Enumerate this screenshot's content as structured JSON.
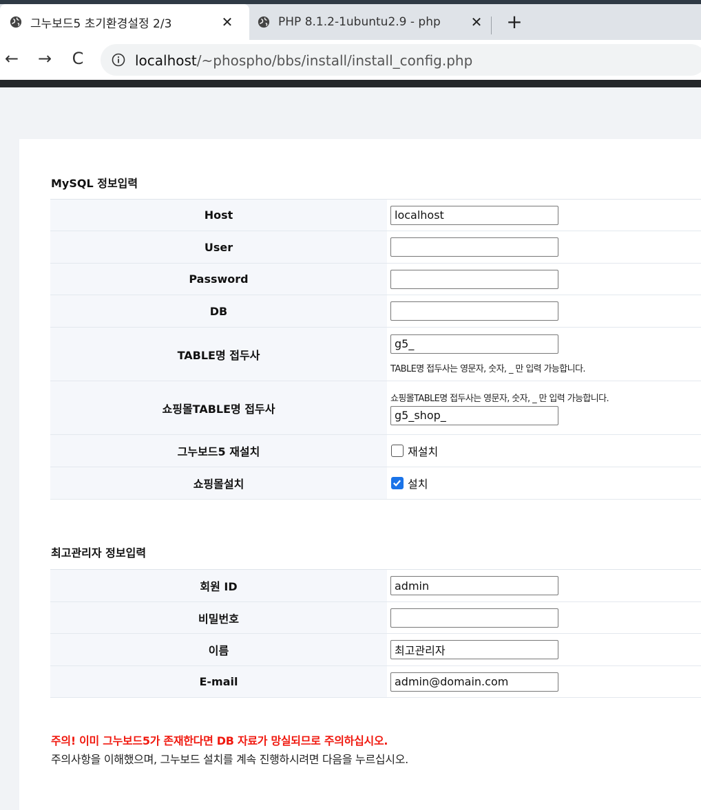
{
  "browser": {
    "tabs": [
      {
        "title": "그누보드5 초기환경설정 2/3",
        "active": true
      },
      {
        "title": "PHP 8.1.2-1ubuntu2.9 - php",
        "active": false
      }
    ],
    "close_glyph": "✕",
    "new_tab_glyph": "+",
    "nav": {
      "back": "←",
      "forward": "→",
      "reload": "C"
    },
    "url_host": "localhost",
    "url_path": "/~phospho/bbs/install/install_config.php"
  },
  "mysql": {
    "title": "MySQL 정보입력",
    "host_label": "Host",
    "host_value": "localhost",
    "user_label": "User",
    "user_value": "",
    "password_label": "Password",
    "password_value": "",
    "db_label": "DB",
    "db_value": "",
    "prefix_label": "TABLE명 접두사",
    "prefix_value": "g5_",
    "prefix_help": "TABLE명 접두사는 영문자, 숫자, _ 만 입력 가능합니다.",
    "shop_prefix_label": "쇼핑몰TABLE명 접두사",
    "shop_prefix_help": "쇼핑몰TABLE명 접두사는 영문자, 숫자, _ 만 입력 가능합니다.",
    "shop_prefix_value": "g5_shop_",
    "reinstall_label": "그누보드5 재설치",
    "reinstall_checkbox": "재설치",
    "reinstall_checked": false,
    "shop_install_label": "쇼핑몰설치",
    "shop_install_checkbox": "설치",
    "shop_install_checked": true
  },
  "admin": {
    "title": "최고관리자 정보입력",
    "id_label": "회원 ID",
    "id_value": "admin",
    "pw_label": "비밀번호",
    "pw_value": "",
    "name_label": "이름",
    "name_value": "최고관리자",
    "email_label": "E-mail",
    "email_value": "admin@domain.com"
  },
  "warning": "주의! 이미 그누보드5가 존재한다면 DB 자료가 망실되므로 주의하십시오.",
  "notice": "주의사항을 이해했으며, 그누보드 설치를 계속 진행하시려면 다음을 누르십시오.",
  "colors": {
    "warning": "#f0190f",
    "checkbox_checked": "#1a73e8"
  }
}
